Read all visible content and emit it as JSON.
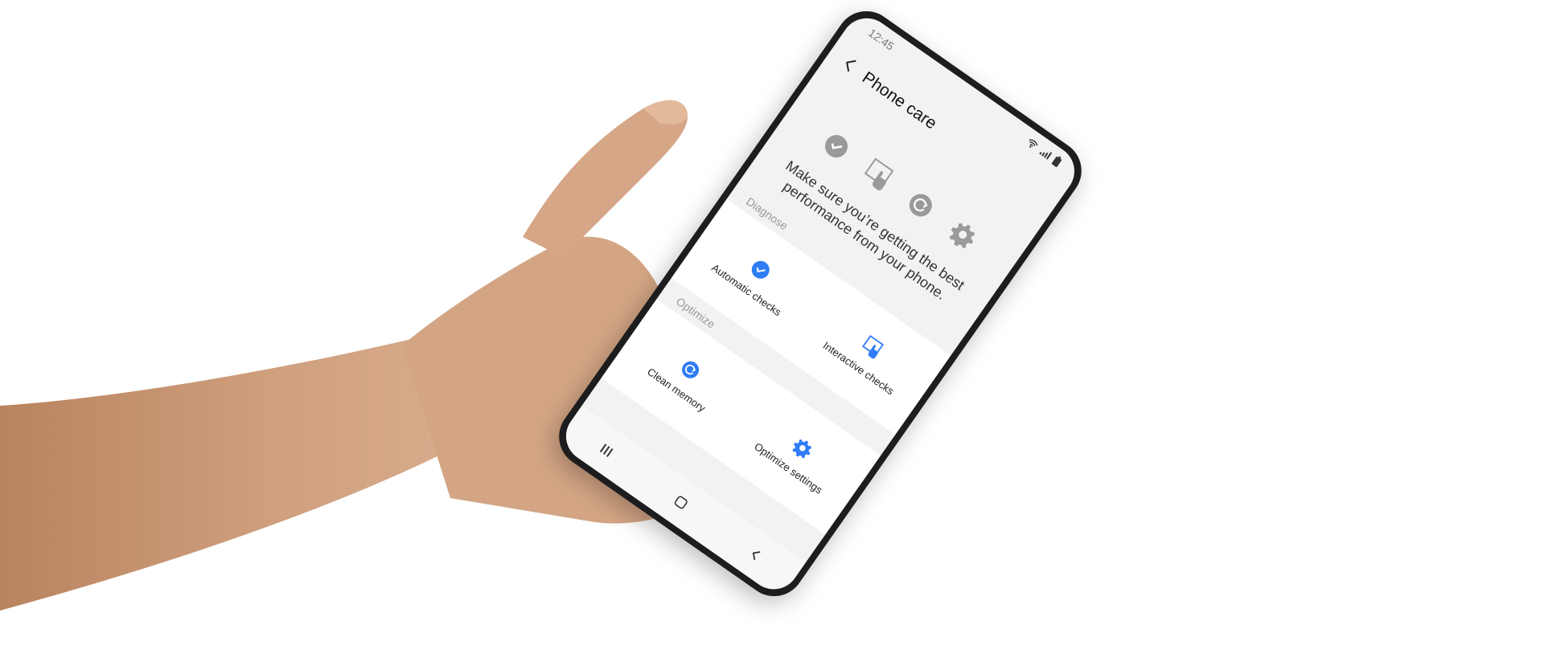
{
  "status_bar": {
    "time": "12:45",
    "wifi_icon": "wifi-icon",
    "signal_icon": "signal-icon",
    "battery_icon": "battery-icon"
  },
  "app_bar": {
    "back_icon": "back-arrow-icon",
    "title": "Phone care"
  },
  "hero": {
    "icons": [
      "check-circle-icon",
      "touch-screen-icon",
      "refresh-circle-icon",
      "gear-icon"
    ],
    "description": "Make sure you’re getting the best performance from your phone."
  },
  "sections": {
    "diagnose": {
      "label": "Diagnose",
      "items": [
        {
          "label": "Automatic checks",
          "icon": "check-circle-icon"
        },
        {
          "label": "Interactive checks",
          "icon": "touch-screen-icon"
        }
      ]
    },
    "optimize": {
      "label": "Optimize",
      "items": [
        {
          "label": "Clean memory",
          "icon": "refresh-circle-icon"
        },
        {
          "label": "Optimize settings",
          "icon": "gear-icon"
        }
      ]
    }
  },
  "nav_bar": {
    "recents_icon": "recents-icon",
    "home_icon": "home-icon",
    "back_icon": "back-icon"
  },
  "colors": {
    "accent": "#2f7cf6",
    "muted_icon": "#9a9a9a",
    "screen_bg": "#f2f2f2",
    "card_bg": "#ffffff",
    "phone_frame": "#1d1d1f",
    "skin": "#c99a78"
  }
}
